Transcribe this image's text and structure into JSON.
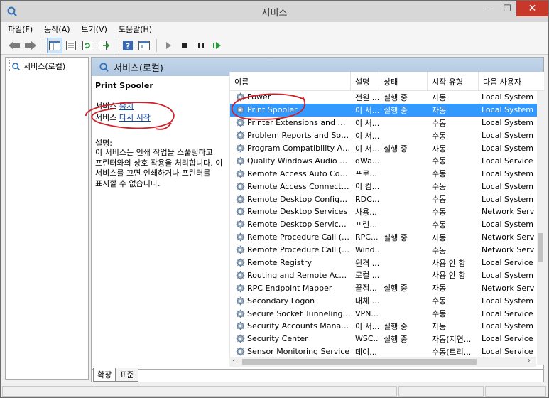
{
  "window": {
    "title": "서비스",
    "minimize": "–",
    "maximize": "☐",
    "close": "✕"
  },
  "menu": [
    "파일(F)",
    "동작(A)",
    "보기(V)",
    "도움말(H)"
  ],
  "toolbar": {
    "icons": [
      "back-arrow-icon",
      "forward-arrow-icon",
      "show-tree-icon",
      "properties-icon",
      "refresh-icon",
      "export-icon",
      "help-icon",
      "view-icon",
      "play-icon",
      "stop-icon",
      "pause-icon",
      "resume-icon"
    ]
  },
  "tree": {
    "root_label": "서비스(로컬)"
  },
  "main": {
    "header": "서비스(로컬)",
    "selected_service": "Print Spooler",
    "actions": [
      {
        "prefix": "서비스 ",
        "link": "중지"
      },
      {
        "prefix": "서비스 ",
        "link": "다시 시작"
      }
    ],
    "desc_label": "설명:",
    "desc_text": "이 서비스는 인쇄 작업을 스풀링하고 프린터와의 상호 작용을 처리합니다. 이 서비스를 끄면 인쇄하거나 프린터를 표시할 수 없습니다."
  },
  "columns": [
    "이름",
    "설명",
    "상태",
    "시작 유형",
    "다음 사용자"
  ],
  "services": [
    {
      "name": "Power",
      "desc": "전원 ...",
      "status": "실행 중",
      "startup": "자동",
      "logon": "Local System"
    },
    {
      "name": "Print Spooler",
      "desc": "이 서...",
      "status": "실행 중",
      "startup": "자동",
      "logon": "Local System"
    },
    {
      "name": "Printer Extensions and Noti...",
      "desc": "이 서...",
      "status": "",
      "startup": "수동",
      "logon": "Local System"
    },
    {
      "name": "Problem Reports and Solut...",
      "desc": "이 서...",
      "status": "",
      "startup": "수동",
      "logon": "Local System"
    },
    {
      "name": "Program Compatibility Assi...",
      "desc": "이 서...",
      "status": "실행 중",
      "startup": "자동",
      "logon": "Local System"
    },
    {
      "name": "Quality Windows Audio Vi...",
      "desc": "qWa...",
      "status": "",
      "startup": "수동",
      "logon": "Local Service"
    },
    {
      "name": "Remote Access Auto Conn...",
      "desc": "프로...",
      "status": "",
      "startup": "수동",
      "logon": "Local System"
    },
    {
      "name": "Remote Access Connection...",
      "desc": "이 컴...",
      "status": "",
      "startup": "수동",
      "logon": "Local System"
    },
    {
      "name": "Remote Desktop Configura...",
      "desc": "RDC...",
      "status": "",
      "startup": "수동",
      "logon": "Local System"
    },
    {
      "name": "Remote Desktop Services",
      "desc": "사용...",
      "status": "",
      "startup": "수동",
      "logon": "Network Service"
    },
    {
      "name": "Remote Desktop Services ...",
      "desc": "프린...",
      "status": "",
      "startup": "수동",
      "logon": "Local System"
    },
    {
      "name": "Remote Procedure Call (RP...",
      "desc": "RPC...",
      "status": "실행 중",
      "startup": "자동",
      "logon": "Network Service"
    },
    {
      "name": "Remote Procedure Call (RP...",
      "desc": "Wind...",
      "status": "",
      "startup": "수동",
      "logon": "Network Service"
    },
    {
      "name": "Remote Registry",
      "desc": "원격 ...",
      "status": "",
      "startup": "사용 안 함",
      "logon": "Local Service"
    },
    {
      "name": "Routing and Remote Access",
      "desc": "로컬 ...",
      "status": "",
      "startup": "사용 안 함",
      "logon": "Local System"
    },
    {
      "name": "RPC Endpoint Mapper",
      "desc": "끝점...",
      "status": "실행 중",
      "startup": "자동",
      "logon": "Network Service"
    },
    {
      "name": "Secondary Logon",
      "desc": "대체 ...",
      "status": "",
      "startup": "수동",
      "logon": "Local System"
    },
    {
      "name": "Secure Socket Tunneling P...",
      "desc": "VPN...",
      "status": "",
      "startup": "수동",
      "logon": "Local Service"
    },
    {
      "name": "Security Accounts Manager",
      "desc": "이 서...",
      "status": "실행 중",
      "startup": "자동",
      "logon": "Local System"
    },
    {
      "name": "Security Center",
      "desc": "WSC...",
      "status": "실행 중",
      "startup": "자동(지연...",
      "logon": "Local Service"
    },
    {
      "name": "Sensor Monitoring Service",
      "desc": "데이...",
      "status": "",
      "startup": "수동(트리...",
      "logon": "Local Service"
    }
  ],
  "tabs": [
    "확장",
    "표준"
  ],
  "colors": {
    "selection": "#3399ff",
    "link": "#0a46a6",
    "annotation": "#d0202a",
    "header_bg": "#c3d6ea"
  }
}
